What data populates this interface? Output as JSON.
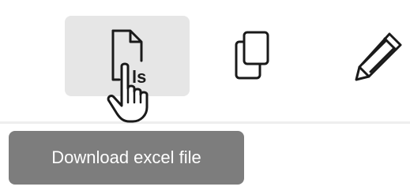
{
  "toolbar": {
    "buttons": [
      {
        "name": "download-excel",
        "icon": "xls-file-icon",
        "state": "hovered"
      },
      {
        "name": "copy",
        "icon": "copy-icon",
        "state": "normal"
      },
      {
        "name": "edit",
        "icon": "pencil-icon",
        "state": "normal"
      }
    ],
    "hover_background": "#e6e6e6"
  },
  "tooltip": {
    "label": "Download excel file",
    "background": "#7d7d7d",
    "color": "#ffffff"
  },
  "cursor": {
    "icon": "hand-pointer-icon"
  }
}
